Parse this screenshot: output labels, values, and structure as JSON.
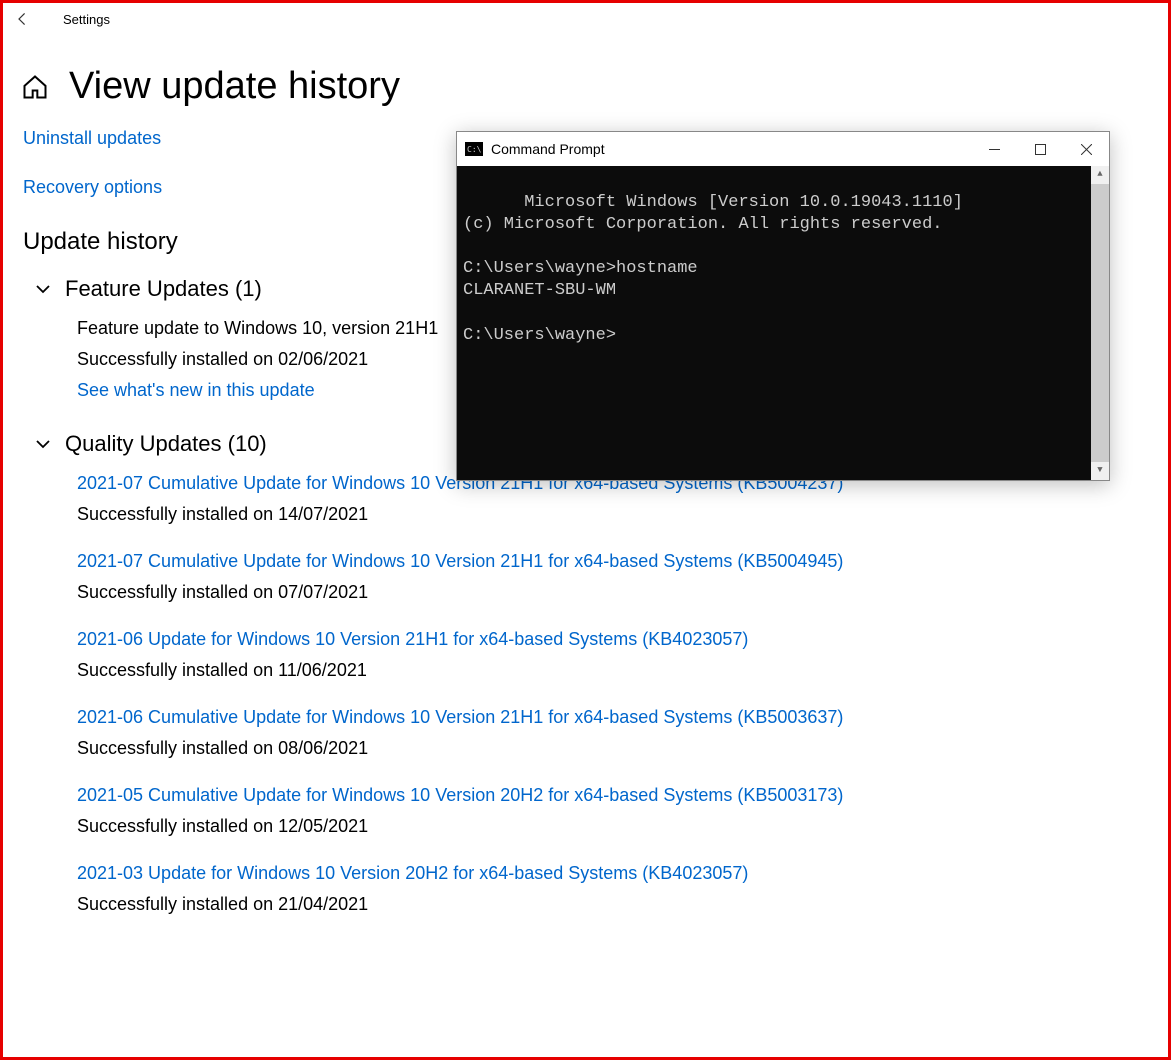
{
  "titlebar": {
    "app_name": "Settings"
  },
  "page": {
    "title": "View update history"
  },
  "links": {
    "uninstall": "Uninstall updates",
    "recovery": "Recovery options"
  },
  "section_heading": "Update history",
  "feature_updates": {
    "header": "Feature Updates (1)",
    "items": [
      {
        "title": "Feature update to Windows 10, version 21H1",
        "status": "Successfully installed on 02/06/2021",
        "action": "See what's new in this update"
      }
    ]
  },
  "quality_updates": {
    "header": "Quality Updates (10)",
    "items": [
      {
        "title": "2021-07 Cumulative Update for Windows 10 Version 21H1 for x64-based Systems (KB5004237)",
        "status": "Successfully installed on 14/07/2021"
      },
      {
        "title": "2021-07 Cumulative Update for Windows 10 Version 21H1 for x64-based Systems (KB5004945)",
        "status": "Successfully installed on 07/07/2021"
      },
      {
        "title": "2021-06 Update for Windows 10 Version 21H1 for x64-based Systems (KB4023057)",
        "status": "Successfully installed on 11/06/2021"
      },
      {
        "title": "2021-06 Cumulative Update for Windows 10 Version 21H1 for x64-based Systems (KB5003637)",
        "status": "Successfully installed on 08/06/2021"
      },
      {
        "title": "2021-05 Cumulative Update for Windows 10 Version 20H2 for x64-based Systems (KB5003173)",
        "status": "Successfully installed on 12/05/2021"
      },
      {
        "title": "2021-03 Update for Windows 10 Version 20H2 for x64-based Systems (KB4023057)",
        "status": "Successfully installed on 21/04/2021"
      }
    ]
  },
  "cmd": {
    "title": "Command Prompt",
    "lines": "Microsoft Windows [Version 10.0.19043.1110]\n(c) Microsoft Corporation. All rights reserved.\n\nC:\\Users\\wayne>hostname\nCLARANET-SBU-WM\n\nC:\\Users\\wayne>"
  }
}
